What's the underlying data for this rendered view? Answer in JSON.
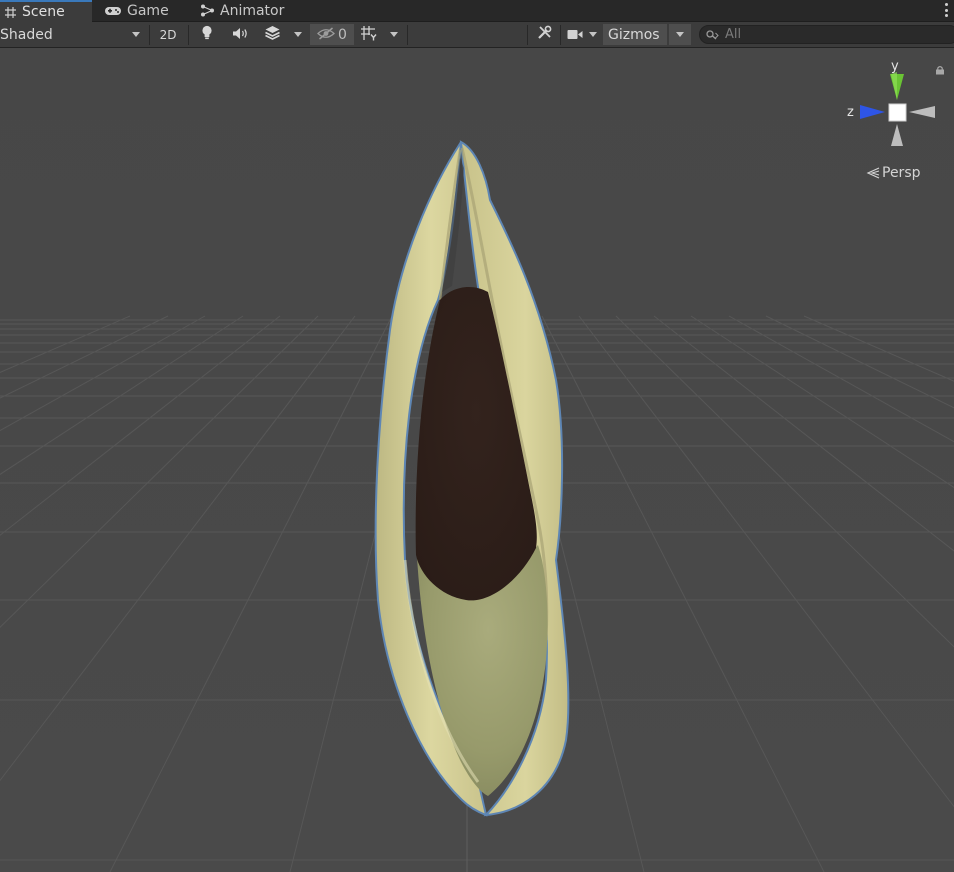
{
  "tabs": [
    {
      "label": "Scene",
      "icon": "grid-icon",
      "active": true
    },
    {
      "label": "Game",
      "icon": "gamepad-icon",
      "active": false
    },
    {
      "label": "Animator",
      "icon": "animator-icon",
      "active": false
    }
  ],
  "toolbar": {
    "draw_mode": "Shaded",
    "mode_2d": "2D",
    "hidden_count": "0",
    "gizmos": "Gizmos",
    "search_placeholder": "All"
  },
  "orientation_gizmo": {
    "y_label": "y",
    "z_label": "z",
    "projection": "Persp",
    "axis_colors": {
      "y": "#6ac434",
      "z": "#2e55e6",
      "x_neg": "#bdbdbd"
    }
  },
  "colors": {
    "accent": "#3a79bb",
    "viewport_bg": "#474747",
    "selection_outline": "#5e86b4",
    "husk": "#d9d49a",
    "seed": "#2d1f1a",
    "inner_green": "#9ea073"
  }
}
